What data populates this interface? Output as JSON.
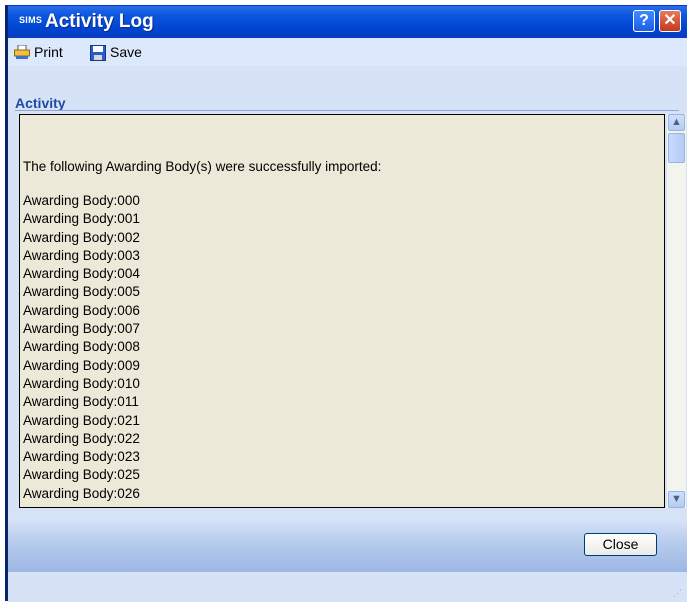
{
  "window": {
    "app_badge": "SIMS",
    "title": "Activity Log",
    "help_glyph": "?",
    "close_glyph": "✕"
  },
  "toolbar": {
    "print_label": "Print",
    "save_label": "Save"
  },
  "section": {
    "title": "Activity"
  },
  "log": {
    "heading": "The following Awarding Body(s) were successfully imported:",
    "entries": [
      "Awarding Body:000",
      "Awarding Body:001",
      "Awarding Body:002",
      "Awarding Body:003",
      "Awarding Body:004",
      "Awarding Body:005",
      "Awarding Body:006",
      "Awarding Body:007",
      "Awarding Body:008",
      "Awarding Body:009",
      "Awarding Body:010",
      "Awarding Body:011",
      "Awarding Body:021",
      "Awarding Body:022",
      "Awarding Body:023",
      "Awarding Body:025",
      "Awarding Body:026"
    ]
  },
  "footer": {
    "close_label": "Close"
  },
  "colors": {
    "title_bar": "#0a56e0",
    "log_background": "#ece9d8",
    "section_title": "#2349a6"
  },
  "icons": {
    "print": "printer-icon",
    "save": "floppy-disk-icon",
    "scroll_up": "chevron-up-icon",
    "scroll_down": "chevron-down-icon"
  }
}
